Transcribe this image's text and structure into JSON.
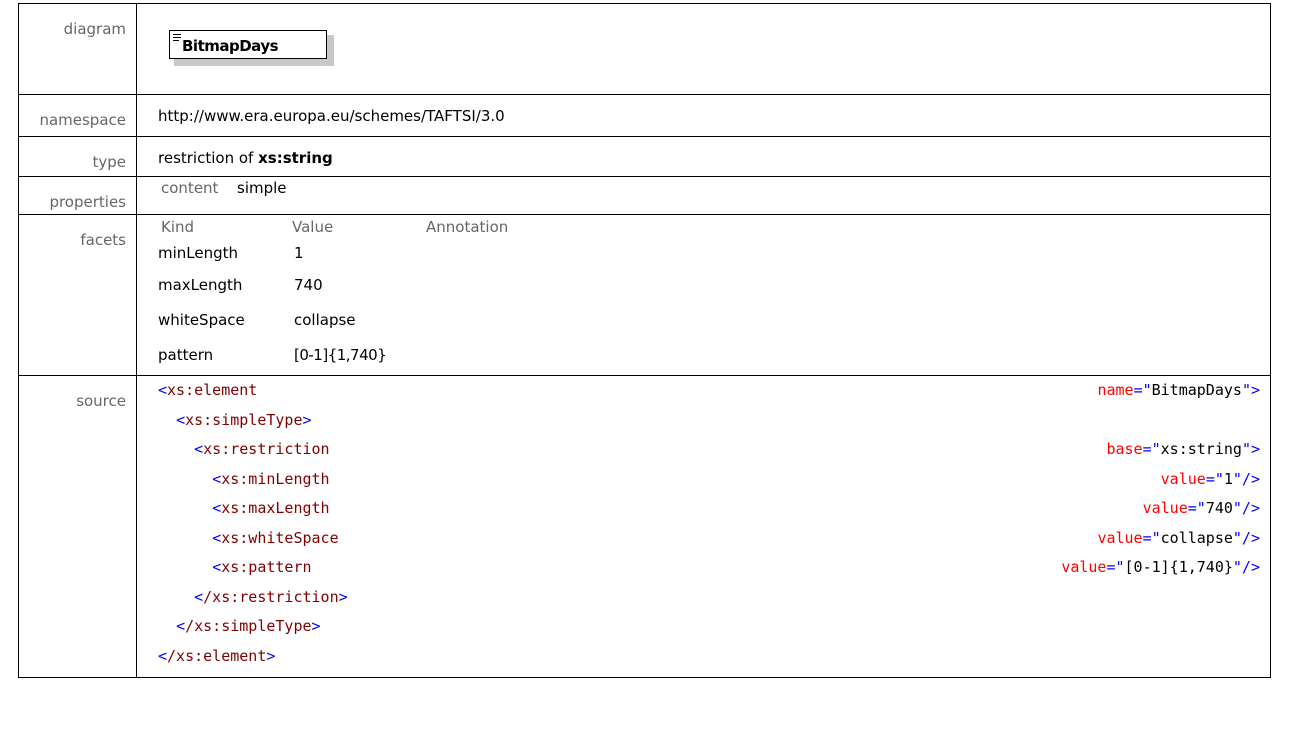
{
  "labels": {
    "diagram": "diagram",
    "namespace": "namespace",
    "type": "type",
    "properties": "properties",
    "facets": "facets",
    "source": "source"
  },
  "diagram": {
    "element_name": "BitmapDays"
  },
  "namespace": "http://www.era.europa.eu/schemes/TAFTSI/3.0",
  "type": {
    "prefix": "restriction of",
    "base": "xs:string"
  },
  "properties": {
    "key": "content",
    "value": "simple"
  },
  "facets": {
    "headers": {
      "kind": "Kind",
      "value": "Value",
      "annotation": "Annotation"
    },
    "rows": [
      {
        "kind": "minLength",
        "value": "1"
      },
      {
        "kind": "maxLength",
        "value": "740"
      },
      {
        "kind": "whiteSpace",
        "value": "collapse"
      },
      {
        "kind": "pattern",
        "value": "[0-1]{1,740}"
      }
    ]
  },
  "source": {
    "lines": [
      {
        "indent": "",
        "tag": "xs:element",
        "attr": "name",
        "val": "BitmapDays",
        "close": "\">"
      },
      {
        "indent": "  ",
        "tag": "xs:simpleType",
        "attr": "",
        "val": "",
        "close": ">"
      },
      {
        "indent": "    ",
        "tag": "xs:restriction",
        "attr": "base",
        "val": "xs:string",
        "close": "\">"
      },
      {
        "indent": "      ",
        "tag": "xs:minLength",
        "attr": "value",
        "val": "1",
        "close": "\"/>"
      },
      {
        "indent": "      ",
        "tag": "xs:maxLength",
        "attr": "value",
        "val": "740",
        "close": "\"/>"
      },
      {
        "indent": "      ",
        "tag": "xs:whiteSpace",
        "attr": "value",
        "val": "collapse",
        "close": "\"/>"
      },
      {
        "indent": "      ",
        "tag": "xs:pattern",
        "attr": "value",
        "val": "[0-1]{1,740}",
        "close": "\"/>"
      },
      {
        "indent": "    ",
        "tag": "/xs:restriction",
        "attr": "",
        "val": "",
        "close": ">"
      },
      {
        "indent": "  ",
        "tag": "/xs:simpleType",
        "attr": "",
        "val": "",
        "close": ">"
      },
      {
        "indent": "",
        "tag": "/xs:element",
        "attr": "",
        "val": "",
        "close": ">"
      }
    ]
  },
  "colors": {
    "markup": "#0000ff",
    "tag": "#800000",
    "attribute": "#ff0000",
    "label": "#666666"
  }
}
